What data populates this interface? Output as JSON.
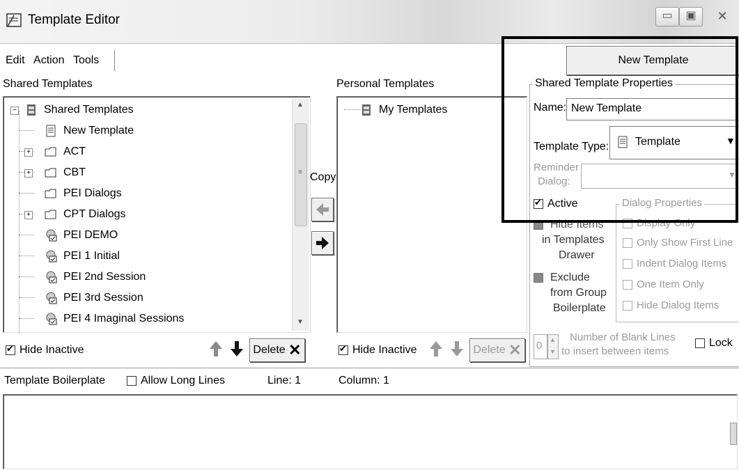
{
  "window": {
    "title": "Template Editor",
    "controls": [
      "minimize",
      "maximize",
      "close"
    ]
  },
  "menu": {
    "items": [
      {
        "label": "Edit"
      },
      {
        "label": "Action"
      },
      {
        "label": "Tools"
      }
    ]
  },
  "shared_panel": {
    "label": "Shared Templates",
    "tree": [
      {
        "label": "Shared Templates",
        "icon": "cabinet-icon",
        "expander": "minus"
      },
      {
        "label": "New Template",
        "icon": "document-icon"
      },
      {
        "label": "ACT",
        "icon": "folder-icon",
        "expander": "plus"
      },
      {
        "label": "CBT",
        "icon": "folder-icon",
        "expander": "plus"
      },
      {
        "label": "PEI Dialogs",
        "icon": "folder-icon"
      },
      {
        "label": "CPT Dialogs",
        "icon": "folder-icon",
        "expander": "plus"
      },
      {
        "label": "PEI DEMO",
        "icon": "dialog-template-icon"
      },
      {
        "label": "PEI 1 Initial",
        "icon": "dialog-template-icon"
      },
      {
        "label": "PEI 2nd Session",
        "icon": "dialog-template-icon"
      },
      {
        "label": "PEI 3rd Session",
        "icon": "dialog-template-icon"
      },
      {
        "label": "PEI 4 Imaginal Sessions",
        "icon": "dialog-template-icon"
      }
    ],
    "hide_inactive_label": "Hide Inactive",
    "hide_inactive_checked": true,
    "delete_label": "Delete"
  },
  "copy": {
    "label": "Copy"
  },
  "personal_panel": {
    "label": "Personal Templates",
    "tree": [
      {
        "label": "My Templates",
        "icon": "cabinet-icon"
      }
    ],
    "hide_inactive_label": "Hide Inactive",
    "hide_inactive_checked": true,
    "delete_label": "Delete"
  },
  "properties": {
    "new_template_button": "New Template",
    "group_title": "Shared Template Properties",
    "name_label": "Name:",
    "name_value": "New Template",
    "type_label": "Template Type:",
    "type_value": "Template",
    "reminder_label_1": "Reminder",
    "reminder_label_2": "Dialog:",
    "active_label": "Active",
    "active_checked": true,
    "hide_items_label_1": "Hide Items",
    "hide_items_label_2": "in Templates",
    "hide_items_label_3": "Drawer",
    "exclude_label_1": "Exclude",
    "exclude_label_2": "from Group",
    "exclude_label_3": "Boilerplate",
    "dialog_props_title": "Dialog Properties",
    "dialog_props": [
      "Display Only",
      "Only Show First Line",
      "Indent Dialog Items",
      "One Item Only",
      "Hide Dialog Items"
    ],
    "blank_lines_value": "0",
    "blank_lines_label_1": "Number of Blank Lines",
    "blank_lines_label_2": "to insert between items",
    "lock_label": "Lock"
  },
  "boilerplate": {
    "label": "Template Boilerplate",
    "allow_long_lines_label": "Allow Long Lines",
    "line_label": "Line: 1",
    "column_label": "Column: 1"
  }
}
